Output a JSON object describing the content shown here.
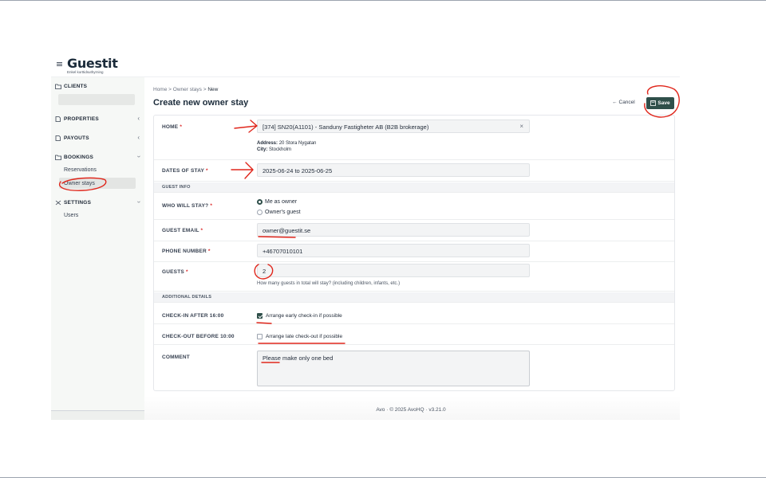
{
  "app": {
    "logo_text": "Guestit",
    "logo_tagline": "Enkel korttidsuthyrning",
    "menu_icon": "hamburger-icon"
  },
  "sidebar": {
    "clients_label": "CLIENTS",
    "properties_label": "PROPERTIES",
    "payouts_label": "PAYOUTS",
    "bookings_label": "BOOKINGS",
    "reservations_label": "Reservations",
    "owner_stays_label": "Owner stays",
    "settings_label": "SETTINGS",
    "users_label": "Users"
  },
  "breadcrumb": {
    "home": "Home",
    "owner_stays": "Owner stays",
    "current": "New",
    "separator": ">"
  },
  "page": {
    "title": "Create new owner stay",
    "cancel_label": "Cancel",
    "save_label": "Save"
  },
  "form": {
    "home_label": "HOME",
    "home_value": "[374] SN20(A1101) - Sanduny Fastigheter AB (B2B brokerage)",
    "address_label": "Address:",
    "address_value": "20 Stora Nygatan",
    "city_label": "City:",
    "city_value": "Stockholm",
    "dates_label": "DATES OF STAY",
    "dates_value": "2025-06-24 to 2025-06-25",
    "guest_info_header": "GUEST INFO",
    "who_label": "WHO WILL STAY?",
    "who_option_owner": "Me as owner",
    "who_option_guest": "Owner's guest",
    "email_label": "GUEST EMAIL",
    "email_value": "owner@guestit.se",
    "phone_label": "PHONE NUMBER",
    "phone_value": "+46707010101",
    "guests_label": "GUESTS",
    "guests_value": "2",
    "guests_hint": "How many guests in total will stay? (including children, infants, etc.)",
    "additional_header": "ADDITIONAL DETAILS",
    "checkin_label": "CHECK-IN AFTER 16:00",
    "checkin_option": "Arrange early check-in if possible",
    "checkin_checked": true,
    "checkout_label": "CHECK-OUT BEFORE 10:00",
    "checkout_option": "Arrange late check-out if possible",
    "checkout_checked": false,
    "comment_label": "COMMENT",
    "comment_value": "Please make only one bed",
    "required_marker": "*",
    "clear_glyph": "×"
  },
  "footer": {
    "text": "Avo · © 2025 AvoHQ · v3.21.0"
  },
  "colors": {
    "accent": "#2f4f4a",
    "annotation": "#e0261b",
    "sidebar_bg": "#f6f8f6"
  }
}
